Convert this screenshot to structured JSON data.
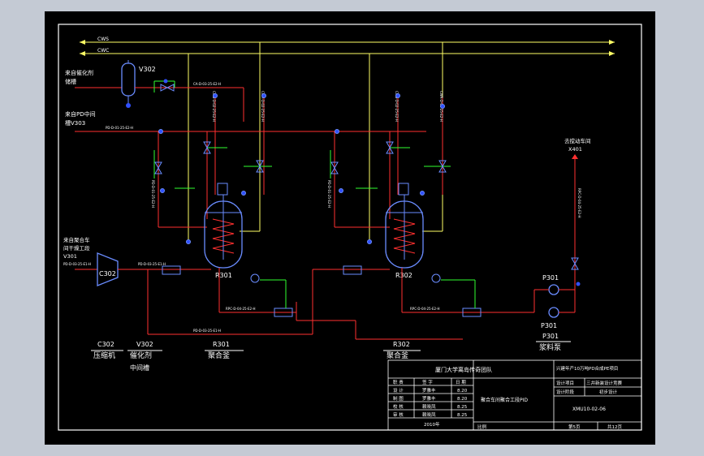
{
  "streams": {
    "cws": "CWS",
    "cwr": "CWC"
  },
  "inlets": {
    "catalyst": [
      "来自催化剂",
      "储槽"
    ],
    "pdtank": [
      "来自PD中间",
      "槽V303"
    ],
    "compressor": [
      "来自聚合车",
      "间干燥工段",
      "V301"
    ],
    "outlet": [
      "去搅动车间",
      "X401"
    ]
  },
  "equipment": {
    "v302": "V302",
    "c302": "C302",
    "r301": "R301",
    "r302": "R302",
    "p301": "P301",
    "p301b": "P301"
  },
  "line_labels": {
    "cat_line": "CA-D-03-25-E2-H",
    "pd_line": "PD-D-01-25-E2-H",
    "comp_line": "PD-D-03-25-E1-H",
    "comp_line_in": "PD-D-03-25-E1-H",
    "bottom_line": "PD-D-03-25-E1-H",
    "r301_out": "RPC-D-04-25-E2-H",
    "r302_out": "RPC-D-04-25-E2-H",
    "v_a": "CWS-D-02-25-E2-H",
    "v_b": "CWR-D-02-25-E2-H",
    "v_c": "CWS-D-02-25-E2-H",
    "v_d": "CWR-D-02-25-E2-H",
    "v_e": "PD-D-01-25-E2-H",
    "v_f": "PD-D-01-25-E2-H",
    "v_out": "RPC-D-04-25-E2-H"
  },
  "legend": [
    {
      "tag": "C302",
      "name": "压缩机",
      "sub": ""
    },
    {
      "tag": "V302",
      "name": "催化剂",
      "sub": "中间槽"
    },
    {
      "tag": "R301",
      "name": "聚合釜",
      "sub": ""
    },
    {
      "tag": "R302",
      "name": "聚合釜",
      "sub": ""
    },
    {
      "tag": "P301",
      "name": "浆料泵",
      "sub": ""
    }
  ],
  "title_block": {
    "org": "厦门大学离岛传奇团队",
    "project": "兴建年产10万吨PD合成PE项目",
    "drawing_title": "聚合车间聚合工段PID",
    "design_item_label": "设计项目",
    "design_item_value": "三井新装设计竞赛",
    "design_stage_label": "设计阶段",
    "design_stage_value": "初步设计",
    "drawing_no": "XMU10-02-06",
    "sheet": "第5页",
    "total": "共12页",
    "year": "2010年",
    "scale": "比例",
    "headers": [
      "职 责",
      "签 字",
      "日 期"
    ],
    "rows": [
      [
        "设 计",
        "罗雅丰",
        "8.20"
      ],
      [
        "制 图",
        "罗雅丰",
        "8.20"
      ],
      [
        "校 核",
        "赖晓凤",
        "8.25"
      ],
      [
        "审 核",
        "赖晓凤",
        "8.25"
      ]
    ]
  }
}
